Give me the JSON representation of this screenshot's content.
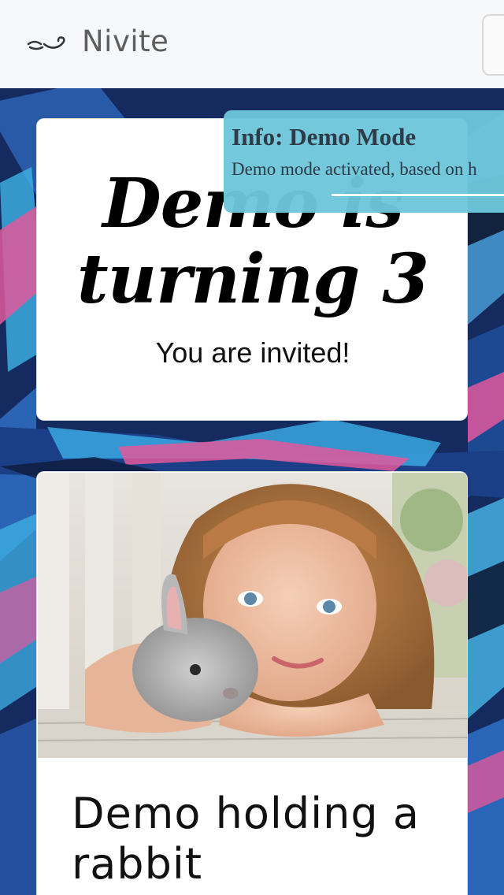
{
  "navbar": {
    "brand_name": "Nivite",
    "logo_icon": "nivite-logo-icon",
    "toggler_icon": "menu-toggle-icon"
  },
  "hero": {
    "headline": "Demo is turning 3",
    "subline": "You are invited!"
  },
  "photo_card": {
    "image": "photo-girl-with-rabbit",
    "caption": "Demo holding a rabbit"
  },
  "toast": {
    "title": "Info: Demo Mode",
    "body": "Demo mode activated, based on h",
    "progress": 0.66
  },
  "colors": {
    "navbar_bg": "#f7f8f9",
    "toast_bg": "#6dc6db",
    "card_bg": "#ffffff",
    "bg_blue": "#1d3a7a",
    "bg_pink": "#e0589b",
    "bg_cyan": "#3fb3e6"
  }
}
